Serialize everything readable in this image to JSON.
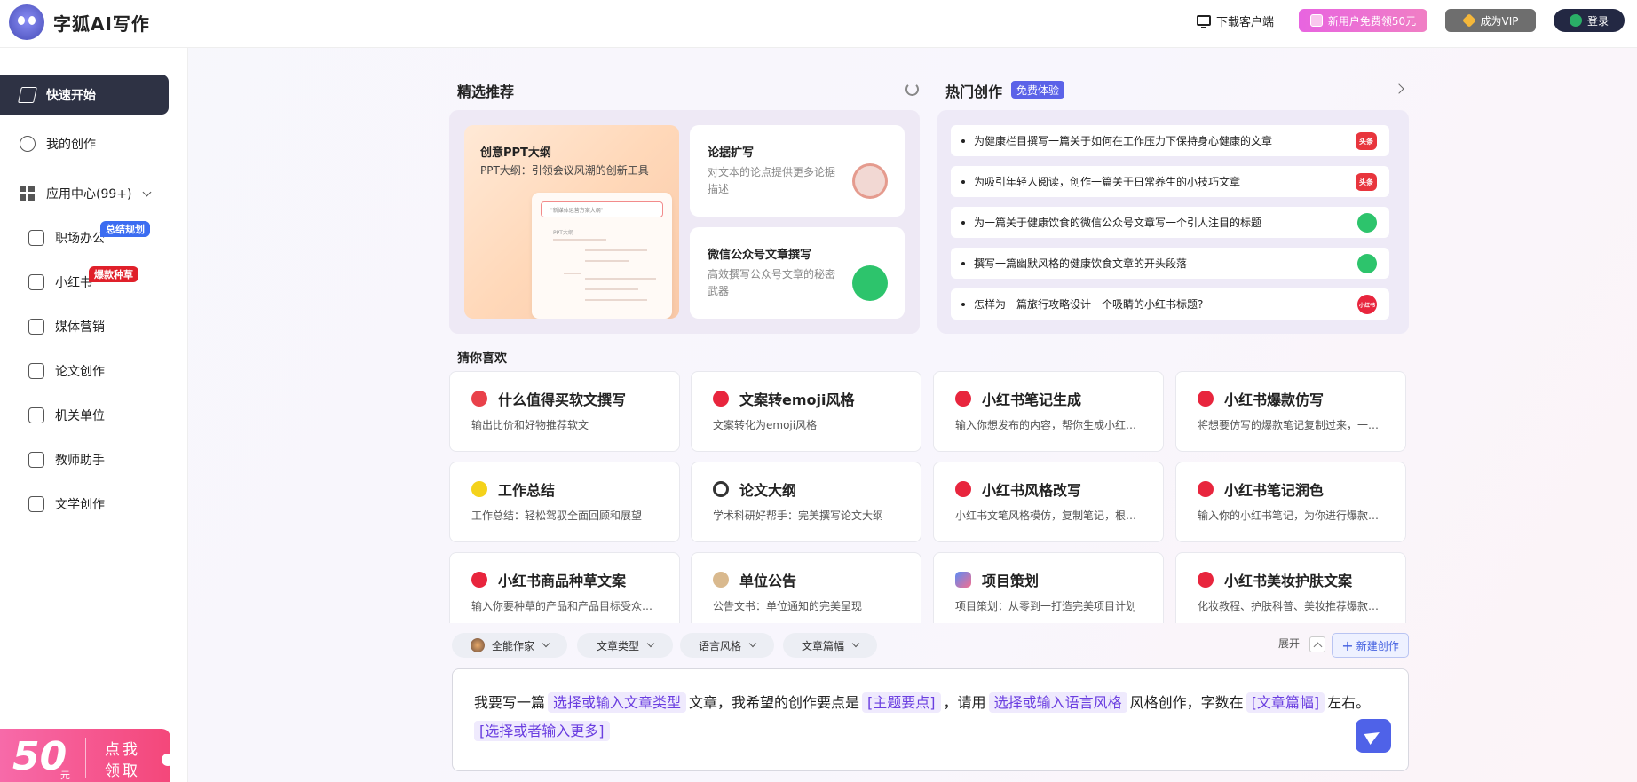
{
  "header": {
    "logo_text": "字狐AI写作",
    "download": "下载客户端",
    "new_user": "新用户免费领50元",
    "vip": "成为VIP",
    "login": "登录"
  },
  "sidebar": {
    "items": [
      {
        "label": "快速开始"
      },
      {
        "label": "我的创作"
      },
      {
        "label": "应用中心(99+)"
      },
      {
        "label": "职场办公",
        "badge": "总结规划"
      },
      {
        "label": "小红书",
        "badge": "爆款种草"
      },
      {
        "label": "媒体营销"
      },
      {
        "label": "论文创作"
      },
      {
        "label": "机关单位"
      },
      {
        "label": "教师助手"
      },
      {
        "label": "文学创作"
      }
    ],
    "promo": {
      "amount": "50",
      "unit": "元",
      "text": "点我领取"
    }
  },
  "featured": {
    "title": "精选推荐",
    "ppt": {
      "title": "创意PPT大纲",
      "desc": "PPT大纲：引领会议风潮的创新工具",
      "doc_bar": "\"新媒体运营方案大纲\"",
      "doc_heading": "PPT大纲"
    },
    "cards": [
      {
        "title": "论据扩写",
        "desc": "对文本的论点提供更多论据描述"
      },
      {
        "title": "微信公众号文章撰写",
        "desc": "高效撰写公众号文章的秘密武器"
      }
    ]
  },
  "hot": {
    "title": "热门创作",
    "tag": "免费体验",
    "items": [
      {
        "text": "为健康栏目撰写一篇关于如何在工作压力下保持身心健康的文章",
        "src": "头条",
        "kind": "toutiao"
      },
      {
        "text": "为吸引年轻人阅读，创作一篇关于日常养生的小技巧文章",
        "src": "头条",
        "kind": "toutiao"
      },
      {
        "text": "为一篇关于健康饮食的微信公众号文章写一个引人注目的标题",
        "src": "",
        "kind": "wechat"
      },
      {
        "text": "撰写一篇幽默风格的健康饮食文章的开头段落",
        "src": "",
        "kind": "wechat"
      },
      {
        "text": "怎样为一篇旅行攻略设计一个吸睛的小红书标题?",
        "src": "小红书",
        "kind": "xhs"
      }
    ]
  },
  "guess": {
    "title": "猜你喜欢",
    "cards": [
      {
        "title": "什么值得买软文撰写",
        "desc": "输出比价和好物推荐软文",
        "icon": "smzdm"
      },
      {
        "title": "文案转emoji风格",
        "desc": "文案转化为emoji风格",
        "icon": "xhs"
      },
      {
        "title": "小红书笔记生成",
        "desc": "输入你想发布的内容，帮你生成小红…",
        "icon": "xhs"
      },
      {
        "title": "小红书爆款仿写",
        "desc": "将想要仿写的爆款笔记复制过来，一…",
        "icon": "xhs"
      },
      {
        "title": "工作总结",
        "desc": "工作总结：轻松驾驭全面回顾和展望",
        "icon": "summary"
      },
      {
        "title": "论文大纲",
        "desc": "学术科研好帮手：完美撰写论文大纲",
        "icon": "paper"
      },
      {
        "title": "小红书风格改写",
        "desc": "小红书文笔风格模仿，复制笔记，根…",
        "icon": "xhs"
      },
      {
        "title": "小红书笔记润色",
        "desc": "输入你的小红书笔记，为你进行爆款…",
        "icon": "xhs"
      },
      {
        "title": "小红书商品种草文案",
        "desc": "输入你要种草的产品和产品目标受众…",
        "icon": "xhs"
      },
      {
        "title": "单位公告",
        "desc": "公告文书：单位通知的完美呈现",
        "icon": "notice"
      },
      {
        "title": "项目策划",
        "desc": "项目策划：从零到一打造完美项目计划",
        "icon": "project"
      },
      {
        "title": "小红书美妆护肤文案",
        "desc": "化妆教程、护肤科普、美妆推荐爆款…",
        "icon": "xhs"
      }
    ]
  },
  "composer": {
    "filters": [
      "全能作家",
      "文章类型",
      "语言风格",
      "文章篇幅"
    ],
    "expand": "展开",
    "new_button": "新建创作",
    "prompt": {
      "p1": "我要写一篇",
      "s1": "选择或输入文章类型",
      "p2": "文章，我希望的创作要点是",
      "s2": "[主题要点]",
      "p3": "，请用",
      "s3": "选择或输入语言风格",
      "p4": "风格创作，字数在",
      "s4": "[文章篇幅]",
      "p5": "左右。",
      "s5": "[选择或者输入更多]"
    }
  }
}
